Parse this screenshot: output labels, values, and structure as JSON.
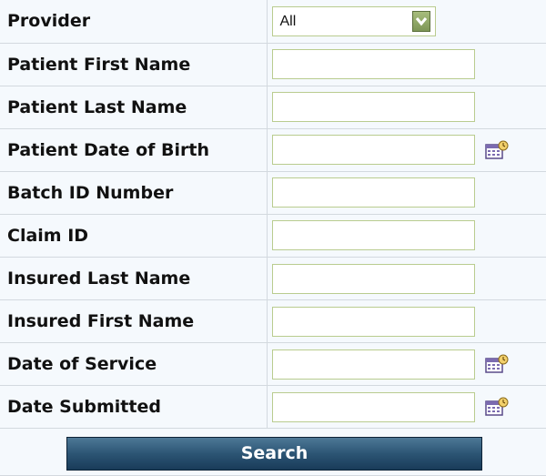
{
  "form": {
    "provider": {
      "label": "Provider",
      "value": "All"
    },
    "fields": [
      {
        "label": "Patient First Name",
        "value": "",
        "calendar": false
      },
      {
        "label": "Patient Last Name",
        "value": "",
        "calendar": false
      },
      {
        "label": "Patient Date of Birth",
        "value": "",
        "calendar": true
      },
      {
        "label": "Batch ID Number",
        "value": "",
        "calendar": false
      },
      {
        "label": "Claim ID",
        "value": "",
        "calendar": false
      },
      {
        "label": "Insured Last Name",
        "value": "",
        "calendar": false
      },
      {
        "label": "Insured First Name",
        "value": "",
        "calendar": false
      },
      {
        "label": "Date of Service",
        "value": "",
        "calendar": true
      },
      {
        "label": "Date Submitted",
        "value": "",
        "calendar": true
      }
    ],
    "search_label": "Search"
  },
  "icons": {
    "dropdown": "chevron-down-icon",
    "calendar": "calendar-icon"
  },
  "colors": {
    "input_border": "#b9cc8f",
    "button": "#2c5574",
    "row_background": "#f5f9fd"
  }
}
